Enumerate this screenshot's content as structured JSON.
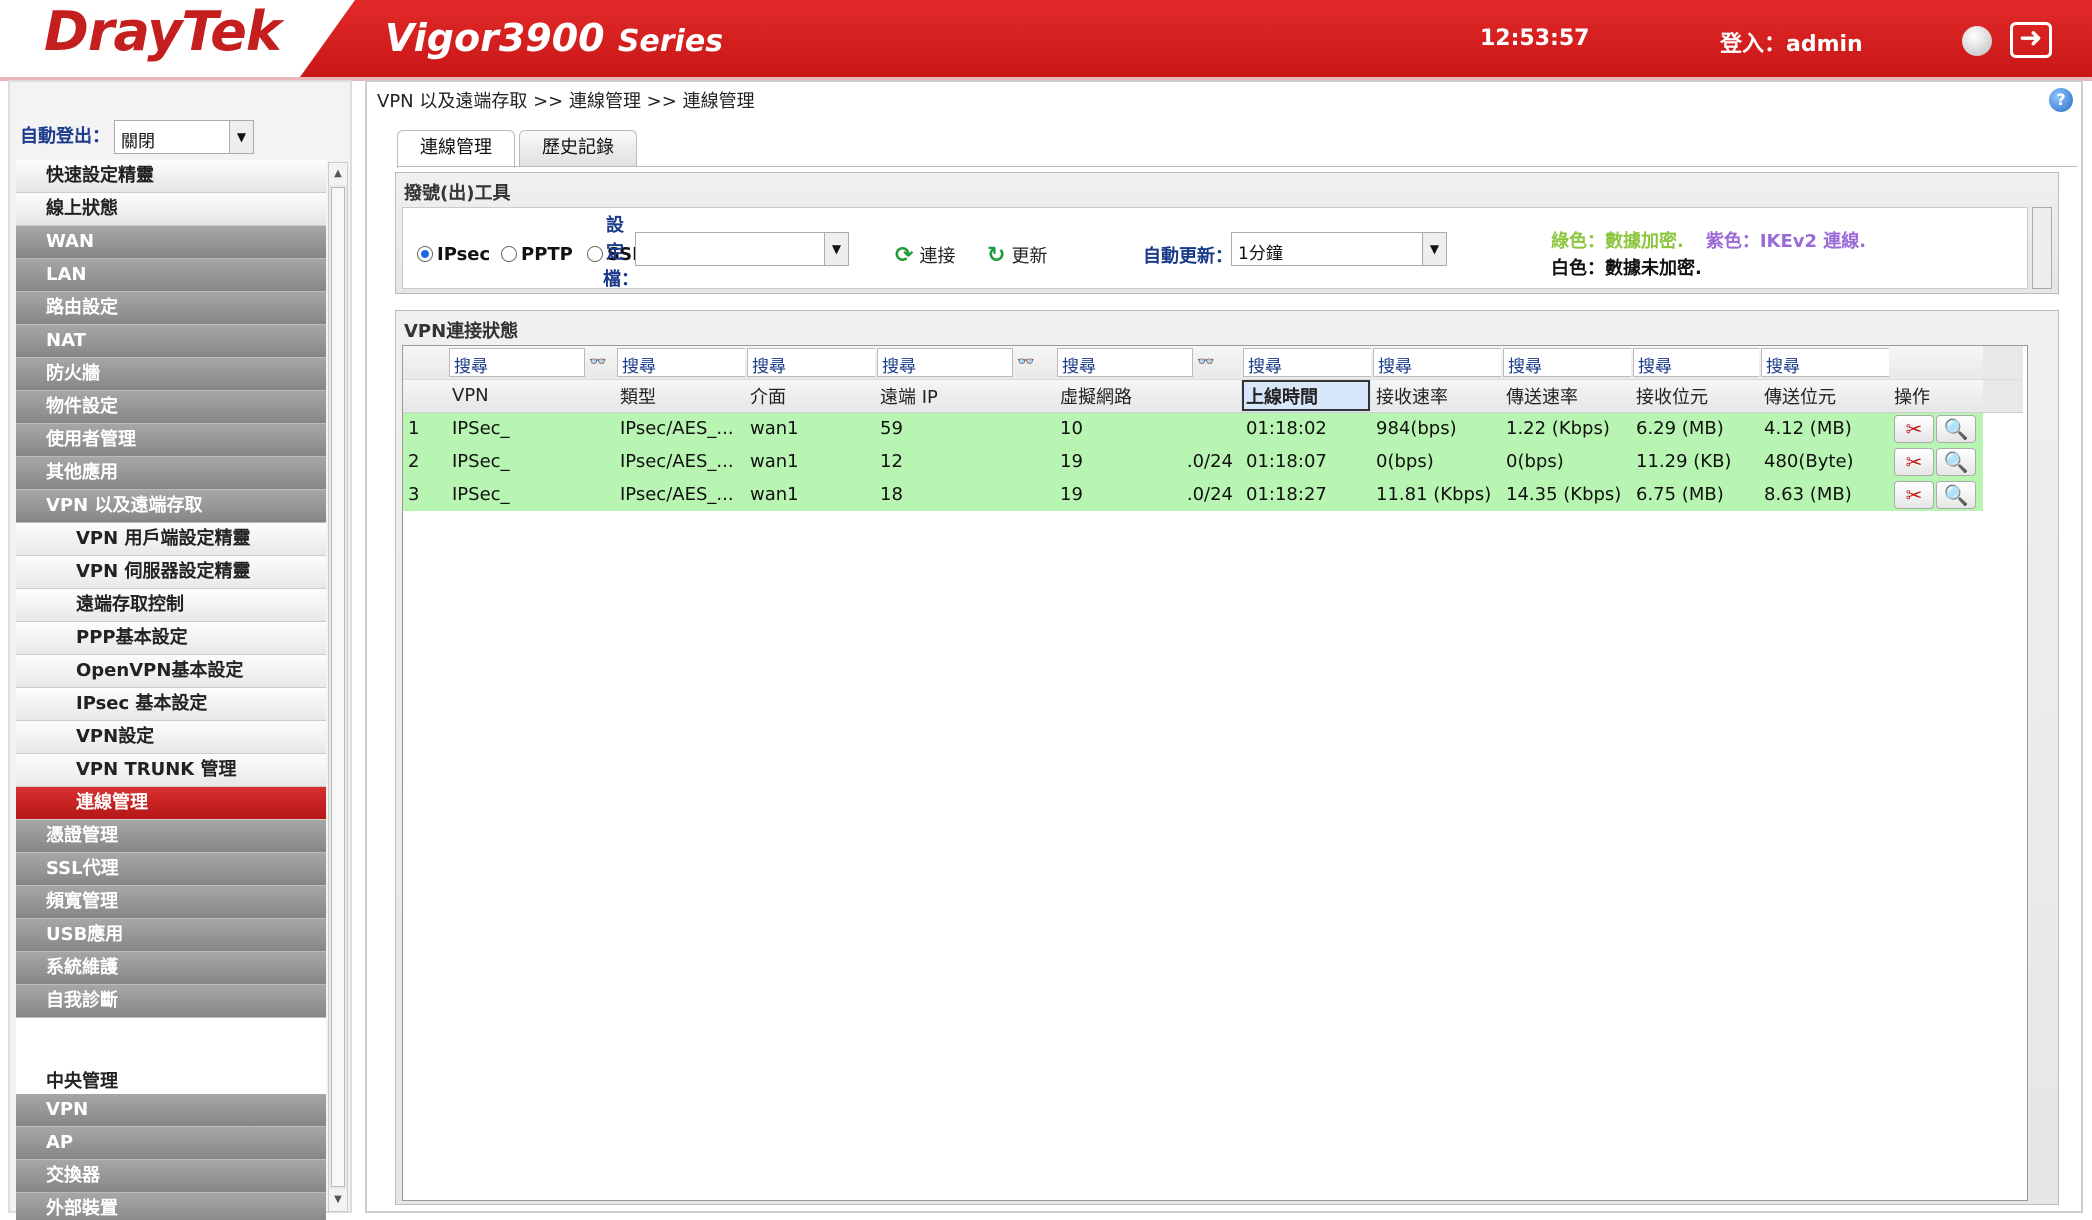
{
  "header": {
    "brand": "DrayTek",
    "model": "Vigor3900",
    "series": "Series",
    "clock": "12:53:57",
    "login": "登入：admin"
  },
  "sidebar": {
    "auto_logout_label": "自動登出：",
    "auto_logout_value": "關閉",
    "menu": [
      {
        "label": "快速設定精靈",
        "style": "light"
      },
      {
        "label": "線上狀態",
        "style": "light"
      },
      {
        "label": "WAN",
        "style": "dark"
      },
      {
        "label": "LAN",
        "style": "dark"
      },
      {
        "label": "路由設定",
        "style": "dark"
      },
      {
        "label": "NAT",
        "style": "dark"
      },
      {
        "label": "防火牆",
        "style": "dark"
      },
      {
        "label": "物件設定",
        "style": "dark"
      },
      {
        "label": "使用者管理",
        "style": "dark"
      },
      {
        "label": "其他應用",
        "style": "dark"
      },
      {
        "label": "VPN 以及遠端存取",
        "style": "dark"
      },
      {
        "label": "VPN 用戶端設定精靈",
        "style": "sub"
      },
      {
        "label": "VPN 伺服器設定精靈",
        "style": "sub"
      },
      {
        "label": "遠端存取控制",
        "style": "sub"
      },
      {
        "label": "PPP基本設定",
        "style": "sub"
      },
      {
        "label": "OpenVPN基本設定",
        "style": "sub"
      },
      {
        "label": "IPsec 基本設定",
        "style": "sub"
      },
      {
        "label": "VPN設定",
        "style": "sub"
      },
      {
        "label": "VPN TRUNK 管理",
        "style": "sub"
      },
      {
        "label": "連線管理",
        "style": "active"
      },
      {
        "label": "憑證管理",
        "style": "dark"
      },
      {
        "label": "SSL代理",
        "style": "dark"
      },
      {
        "label": "頻寬管理",
        "style": "dark"
      },
      {
        "label": "USB應用",
        "style": "dark"
      },
      {
        "label": "系統維護",
        "style": "dark"
      },
      {
        "label": "自我診斷",
        "style": "dark"
      },
      {
        "label": "",
        "style": "spacer"
      },
      {
        "label": "中央管理",
        "style": "plain"
      },
      {
        "label": "VPN",
        "style": "dark"
      },
      {
        "label": "AP",
        "style": "dark"
      },
      {
        "label": "交換器",
        "style": "dark"
      },
      {
        "label": "外部裝置",
        "style": "dark"
      }
    ]
  },
  "main": {
    "breadcrumb": "VPN 以及遠端存取 >> 連線管理 >> 連線管理",
    "tabs": [
      "連線管理",
      "歷史記錄"
    ],
    "dial": {
      "title": "撥號(出)工具",
      "radios": [
        {
          "label": "IPsec",
          "checked": true
        },
        {
          "label": "PPTP",
          "checked": false
        },
        {
          "label": "SSL",
          "checked": false
        }
      ],
      "profile_label": [
        "設",
        "定",
        "檔："
      ],
      "profile_value": "",
      "connect_label": "連接",
      "refresh_label": "更新",
      "auto_refresh_label": "自動更新：",
      "auto_refresh_value": "1分鐘",
      "legend_green": "綠色：數據加密.",
      "legend_purple": "紫色：IKEv2 連線.",
      "legend_white": "白色：數據未加密."
    },
    "status": {
      "title": "VPN連接狀態",
      "search_placeholder": "搜尋",
      "columns": [
        "VPN",
        "類型",
        "介面",
        "遠端 IP",
        "虛擬網路",
        "上線時間",
        "接收速率",
        "傳送速率",
        "接收位元",
        "傳送位元",
        "操作"
      ],
      "sorted_column": "上線時間",
      "rows": [
        {
          "no": "1",
          "vpn": "IPSec_",
          "type": "IPsec/AES_...",
          "iface": "wan1",
          "remote_ip": "59",
          "vnet": "10",
          "vnet_suffix": "",
          "uptime": "01:18:02",
          "rx_rate": "984(bps)",
          "tx_rate": "1.22 (Kbps)",
          "rx_bytes": "6.29 (MB)",
          "tx_bytes": "4.12 (MB)"
        },
        {
          "no": "2",
          "vpn": "IPSec_",
          "type": "IPsec/AES_...",
          "iface": "wan1",
          "remote_ip": "12",
          "vnet": "19",
          "vnet_suffix": ".0/24",
          "uptime": "01:18:07",
          "rx_rate": "0(bps)",
          "tx_rate": "0(bps)",
          "rx_bytes": "11.29 (KB)",
          "tx_bytes": "480(Byte)"
        },
        {
          "no": "3",
          "vpn": "IPSec_",
          "type": "IPsec/AES_...",
          "iface": "wan1",
          "remote_ip": "18",
          "vnet": "19",
          "vnet_suffix": ".0/24",
          "uptime": "01:18:27",
          "rx_rate": "11.81 (Kbps)",
          "tx_rate": "14.35 (Kbps)",
          "rx_bytes": "6.75 (MB)",
          "tx_bytes": "8.63 (MB)"
        }
      ],
      "row_color": "#b8f5b2"
    }
  }
}
